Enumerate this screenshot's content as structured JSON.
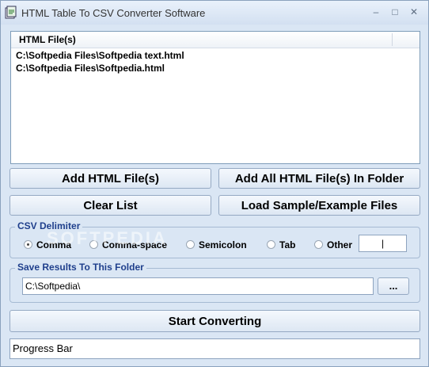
{
  "window": {
    "title": "HTML Table To CSV Converter Software",
    "controls": {
      "minimize": "–",
      "maximize": "□",
      "close": "✕"
    }
  },
  "file_list": {
    "header": "HTML File(s)",
    "items": [
      "C:\\Softpedia Files\\Softpedia text.html",
      "C:\\Softpedia Files\\Softpedia.html"
    ]
  },
  "buttons": {
    "add_files": "Add HTML File(s)",
    "add_folder": "Add All HTML File(s) In Folder",
    "clear_list": "Clear List",
    "load_sample": "Load Sample/Example Files",
    "browse": "...",
    "start": "Start Converting"
  },
  "delimiter": {
    "legend": "CSV Delimiter",
    "options": [
      "Comma",
      "Comma-space",
      "Semicolon",
      "Tab",
      "Other"
    ],
    "selected": "Comma",
    "other_value": "|"
  },
  "save": {
    "legend": "Save Results To This Folder",
    "folder": "C:\\Softpedia\\"
  },
  "progress": {
    "label": "Progress Bar"
  },
  "watermark": "SOFTPEDIA"
}
